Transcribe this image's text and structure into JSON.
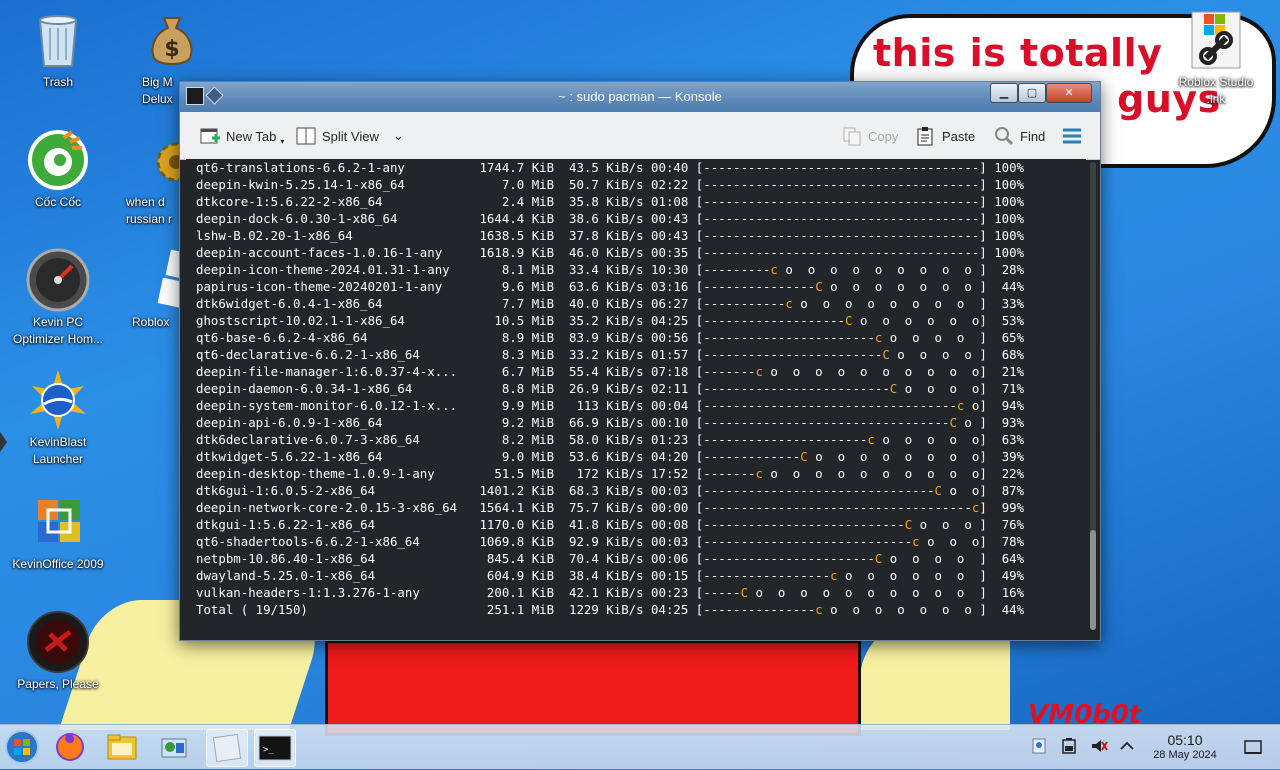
{
  "wallpaper": {
    "bubble_text": "this is totally windows 7 guys",
    "signature": "VM0b0t"
  },
  "desktop_icons": [
    {
      "label": "Trash",
      "icon": "trash-icon"
    },
    {
      "label": "Big M\nDelux",
      "icon": "money-bag-icon"
    },
    {
      "label": "Cốc Cốc",
      "icon": "coccoc-browser-icon"
    },
    {
      "label": "when d\nrussian r",
      "icon": "gear-icon"
    },
    {
      "label": "Kevin PC\nOptimizer Hom...",
      "icon": "speedometer-icon"
    },
    {
      "label": "Roblox",
      "icon": "roblox-icon"
    },
    {
      "label": "KevinBlast\nLauncher",
      "icon": "blast-launcher-icon"
    },
    {
      "label": "KevinOffice 2009",
      "icon": "office-icon"
    },
    {
      "label": "Papers, Please",
      "icon": "papers-please-icon"
    },
    {
      "label": "Roblox Studio\n.lnk",
      "icon": "shortcut-link-icon"
    }
  ],
  "window": {
    "title": "~ : sudo pacman — Konsole",
    "toolbar": {
      "new_tab": "New Tab",
      "split_view": "Split View",
      "copy": "Copy",
      "paste": "Paste",
      "find": "Find"
    }
  },
  "terminal": {
    "rows": [
      {
        "name": "qt6-translations-6.6.2-1-any",
        "size": "1744.7 KiB",
        "rate": "43.5 KiB/s",
        "eta": "00:40",
        "pct": 100
      },
      {
        "name": "deepin-kwin-5.25.14-1-x86_64",
        "size": "7.0 MiB",
        "rate": "50.7 KiB/s",
        "eta": "02:22",
        "pct": 100
      },
      {
        "name": "dtkcore-1:5.6.22-2-x86_64",
        "size": "2.4 MiB",
        "rate": "35.8 KiB/s",
        "eta": "01:08",
        "pct": 100
      },
      {
        "name": "deepin-dock-6.0.30-1-x86_64",
        "size": "1644.4 KiB",
        "rate": "38.6 KiB/s",
        "eta": "00:43",
        "pct": 100
      },
      {
        "name": "lshw-B.02.20-1-x86_64",
        "size": "1638.5 KiB",
        "rate": "37.8 KiB/s",
        "eta": "00:43",
        "pct": 100
      },
      {
        "name": "deepin-account-faces-1.0.16-1-any",
        "size": "1618.9 KiB",
        "rate": "46.0 KiB/s",
        "eta": "00:35",
        "pct": 100
      },
      {
        "name": "deepin-icon-theme-2024.01.31-1-any",
        "size": "8.1 MiB",
        "rate": "33.4 KiB/s",
        "eta": "10:30",
        "pct": 28
      },
      {
        "name": "papirus-icon-theme-20240201-1-any",
        "size": "9.6 MiB",
        "rate": "63.6 KiB/s",
        "eta": "03:16",
        "pct": 44
      },
      {
        "name": "dtk6widget-6.0.4-1-x86_64",
        "size": "7.7 MiB",
        "rate": "40.0 KiB/s",
        "eta": "06:27",
        "pct": 33
      },
      {
        "name": "ghostscript-10.02.1-1-x86_64",
        "size": "10.5 MiB",
        "rate": "35.2 KiB/s",
        "eta": "04:25",
        "pct": 53
      },
      {
        "name": "qt6-base-6.6.2-4-x86_64",
        "size": "8.9 MiB",
        "rate": "83.9 KiB/s",
        "eta": "00:56",
        "pct": 65
      },
      {
        "name": "qt6-declarative-6.6.2-1-x86_64",
        "size": "8.3 MiB",
        "rate": "33.2 KiB/s",
        "eta": "01:57",
        "pct": 68
      },
      {
        "name": "deepin-file-manager-1:6.0.37-4-x...",
        "size": "6.7 MiB",
        "rate": "55.4 KiB/s",
        "eta": "07:18",
        "pct": 21
      },
      {
        "name": "deepin-daemon-6.0.34-1-x86_64",
        "size": "8.8 MiB",
        "rate": "26.9 KiB/s",
        "eta": "02:11",
        "pct": 71
      },
      {
        "name": "deepin-system-monitor-6.0.12-1-x...",
        "size": "9.9 MiB",
        "rate": "113 KiB/s",
        "eta": "00:04",
        "pct": 94
      },
      {
        "name": "deepin-api-6.0.9-1-x86_64",
        "size": "9.2 MiB",
        "rate": "66.9 KiB/s",
        "eta": "00:10",
        "pct": 93
      },
      {
        "name": "dtk6declarative-6.0.7-3-x86_64",
        "size": "8.2 MiB",
        "rate": "58.0 KiB/s",
        "eta": "01:23",
        "pct": 63
      },
      {
        "name": "dtkwidget-5.6.22-1-x86_64",
        "size": "9.0 MiB",
        "rate": "53.6 KiB/s",
        "eta": "04:20",
        "pct": 39
      },
      {
        "name": "deepin-desktop-theme-1.0.9-1-any",
        "size": "51.5 MiB",
        "rate": "172 KiB/s",
        "eta": "17:52",
        "pct": 22
      },
      {
        "name": "dtk6gui-1:6.0.5-2-x86_64",
        "size": "1401.2 KiB",
        "rate": "68.3 KiB/s",
        "eta": "00:03",
        "pct": 87
      },
      {
        "name": "deepin-network-core-2.0.15-3-x86_64",
        "size": "1564.1 KiB",
        "rate": "75.7 KiB/s",
        "eta": "00:00",
        "pct": 99
      },
      {
        "name": "dtkgui-1:5.6.22-1-x86_64",
        "size": "1170.0 KiB",
        "rate": "41.8 KiB/s",
        "eta": "00:08",
        "pct": 76
      },
      {
        "name": "qt6-shadertools-6.6.2-1-x86_64",
        "size": "1069.8 KiB",
        "rate": "92.9 KiB/s",
        "eta": "00:03",
        "pct": 78
      },
      {
        "name": "netpbm-10.86.40-1-x86_64",
        "size": "845.4 KiB",
        "rate": "70.4 KiB/s",
        "eta": "00:06",
        "pct": 64
      },
      {
        "name": "dwayland-5.25.0-1-x86_64",
        "size": "604.9 KiB",
        "rate": "38.4 KiB/s",
        "eta": "00:15",
        "pct": 49
      },
      {
        "name": "vulkan-headers-1:1.3.276-1-any",
        "size": "200.1 KiB",
        "rate": "42.1 KiB/s",
        "eta": "00:23",
        "pct": 16
      },
      {
        "name": "Total ( 19/150)",
        "size": "251.1 MiB",
        "rate": "1229 KiB/s",
        "eta": "04:25",
        "pct": 44
      }
    ]
  },
  "taskbar": {
    "items": [
      "start-orb-icon",
      "firefox-icon",
      "file-explorer-icon",
      "control-panel-icon",
      "app-window-icon",
      "konsole-terminal-icon"
    ],
    "tray": [
      "action-center-icon",
      "battery-icon",
      "volume-muted-icon",
      "chevron-up-icon"
    ],
    "time": "05:10",
    "date": "28 May 2024"
  },
  "colors": {
    "terminal_bg": "#232629",
    "pacman": "#f0a020",
    "titlebar": "#5d88b7"
  }
}
